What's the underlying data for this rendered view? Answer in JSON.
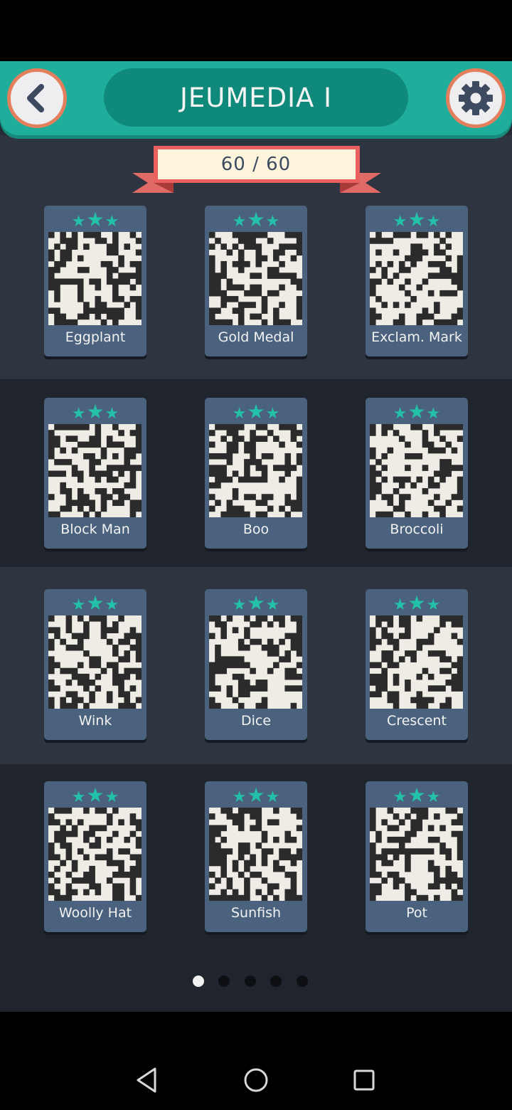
{
  "header": {
    "title": "JEUMEDIA I",
    "back_icon": "chevron-left-icon",
    "settings_icon": "gear-icon"
  },
  "progress": {
    "label": "60 / 60",
    "completed": 60,
    "total": 60
  },
  "levels": [
    {
      "name": "Eggplant",
      "stars": 3
    },
    {
      "name": "Gold Medal",
      "stars": 3
    },
    {
      "name": "Exclam. Mark",
      "stars": 3
    },
    {
      "name": "Block Man",
      "stars": 3
    },
    {
      "name": "Boo",
      "stars": 3
    },
    {
      "name": "Broccoli",
      "stars": 3
    },
    {
      "name": "Wink",
      "stars": 3
    },
    {
      "name": "Dice",
      "stars": 3
    },
    {
      "name": "Crescent",
      "stars": 3
    },
    {
      "name": "Woolly Hat",
      "stars": 3
    },
    {
      "name": "Sunfish",
      "stars": 3
    },
    {
      "name": "Pot",
      "stars": 3
    }
  ],
  "pagination": {
    "pages": 5,
    "current": 1
  },
  "colors": {
    "accent": "#1fae9c",
    "star": "#24c1a9",
    "card": "#4a627d",
    "ribbon": "#e05a5a"
  },
  "nav": {
    "back": "triangle-back-icon",
    "home": "circle-home-icon",
    "recents": "square-recents-icon"
  }
}
